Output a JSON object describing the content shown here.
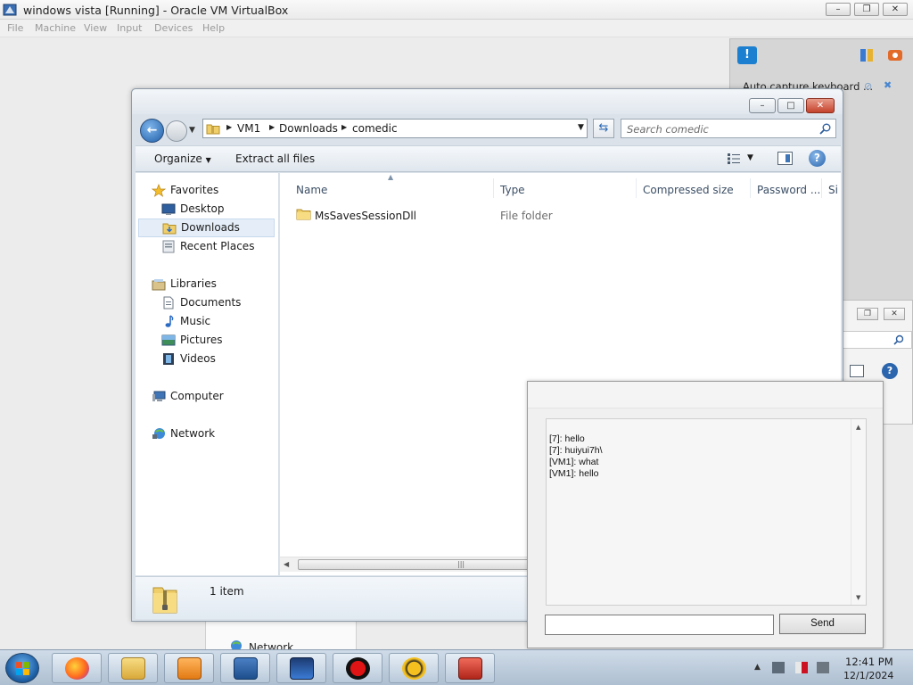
{
  "host": {
    "title": "windows vista [Running] - Oracle VM VirtualBox",
    "menu": [
      "File",
      "Machine",
      "View",
      "Input",
      "Devices",
      "Help"
    ],
    "notice_text": "Auto capture keyboard ..."
  },
  "explorer": {
    "breadcrumb": [
      "VM1",
      "Downloads",
      "comedic"
    ],
    "search_placeholder": "Search comedic",
    "toolbar": {
      "organize": "Organize",
      "extract": "Extract all files"
    },
    "nav": {
      "favorites": "Favorites",
      "desktop": "Desktop",
      "downloads": "Downloads",
      "recent": "Recent Places",
      "libraries": "Libraries",
      "documents": "Documents",
      "music": "Music",
      "pictures": "Pictures",
      "videos": "Videos",
      "computer": "Computer",
      "network": "Network"
    },
    "columns": {
      "name": "Name",
      "type": "Type",
      "compressed": "Compressed size",
      "password": "Password ...",
      "size": "Si"
    },
    "rows": [
      {
        "name": "MsSavesSessionDll",
        "type": "File folder"
      }
    ],
    "item_count": "1 item"
  },
  "background": {
    "network": "Network"
  },
  "chat": {
    "messages": [
      "[7]: hello",
      "[7]: huiyui7h\\",
      "[VM1]: what",
      "[VM1]: hello"
    ],
    "input_value": "",
    "send_label": "Send"
  },
  "taskbar": {
    "time": "12:41 PM",
    "date": "12/1/2024"
  },
  "colors": {
    "accent": "#1d7fcf",
    "close": "#c4422c",
    "taskbar": "#b9c9da"
  }
}
